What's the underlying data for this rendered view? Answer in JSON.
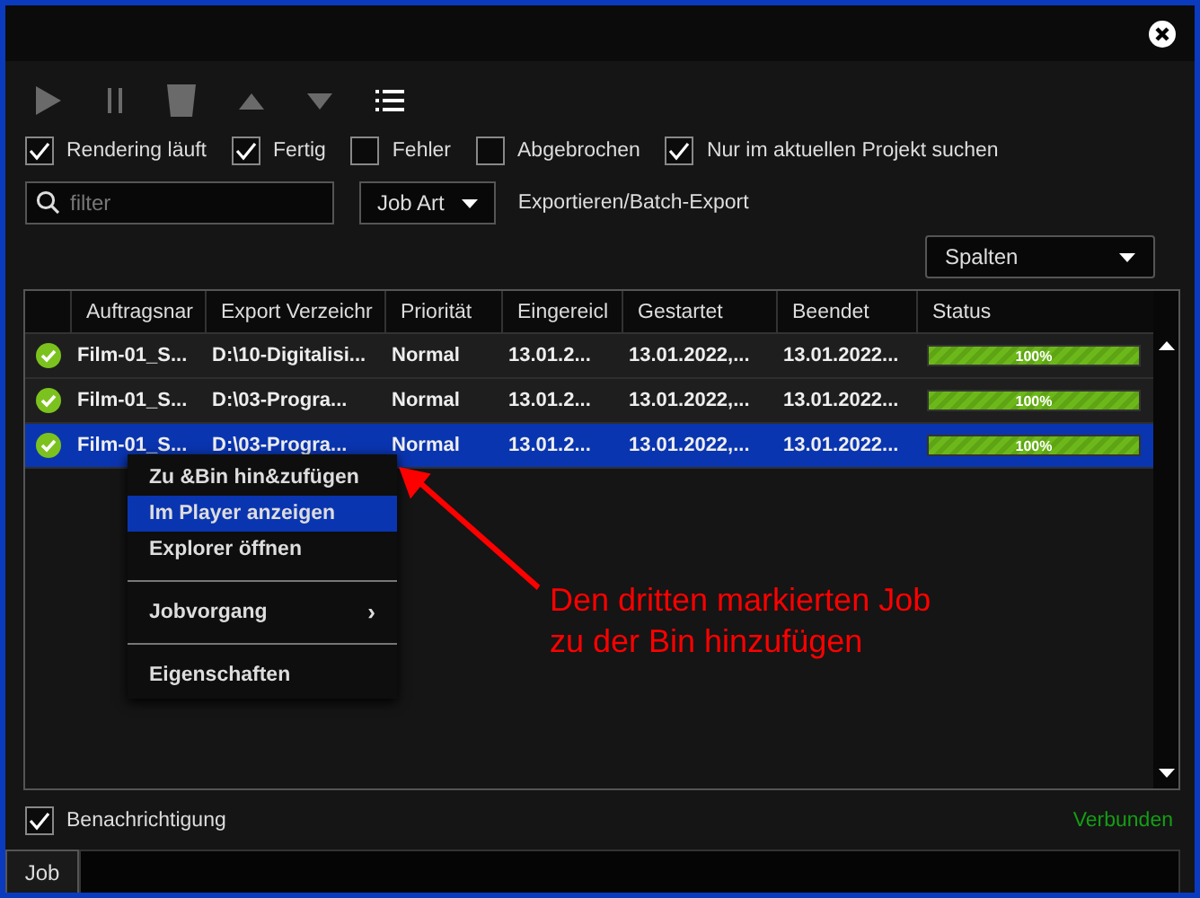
{
  "filters": [
    {
      "label": "Rendering läuft",
      "checked": true
    },
    {
      "label": "Fertig",
      "checked": true
    },
    {
      "label": "Fehler",
      "checked": false
    },
    {
      "label": "Abgebrochen",
      "checked": false
    },
    {
      "label": "Nur im aktuellen Projekt suchen",
      "checked": true
    }
  ],
  "filter_field": {
    "placeholder": "filter"
  },
  "job_type": {
    "label": "Job Art",
    "value": "Exportieren/Batch-Export"
  },
  "columns_button": {
    "label": "Spalten"
  },
  "table": {
    "columns": [
      "Auftragsnar",
      "Export Verzeichr",
      "Priorität",
      "Eingereicl",
      "Gestartet",
      "Beendet",
      "Status"
    ],
    "rows": [
      {
        "selected": false,
        "done": true,
        "cells": [
          "Film-01_S...",
          "D:\\10-Digitalisi...",
          "Normal",
          "13.01.2...",
          "13.01.2022,...",
          "13.01.2022..."
        ],
        "progress": {
          "level": 1,
          "text": "100%"
        }
      },
      {
        "selected": false,
        "done": true,
        "cells": [
          "Film-01_S...",
          "D:\\03-Progra...",
          "Normal",
          "13.01.2...",
          "13.01.2022,...",
          "13.01.2022..."
        ],
        "progress": {
          "level": 1,
          "text": "100%"
        }
      },
      {
        "selected": true,
        "done": true,
        "cells": [
          "Film-01_S...",
          "D:\\03-Progra...",
          "Normal",
          "13.01.2...",
          "13.01.2022,...",
          "13.01.2022..."
        ],
        "progress": {
          "level": 1,
          "text": "100%"
        }
      }
    ]
  },
  "context_menu": {
    "groups": [
      [
        {
          "label": "Zu &Bin hin&zufügen",
          "selected": false
        },
        {
          "label": "Im Player anzeigen",
          "selected": true
        },
        {
          "label": "Explorer öffnen",
          "selected": false
        }
      ],
      [
        {
          "label": "Jobvorgang",
          "selected": false,
          "arrow": "›"
        }
      ],
      [
        {
          "label": "Eigenschaften",
          "selected": false
        }
      ]
    ]
  },
  "annotation": {
    "lines": [
      "Den dritten markierten Job",
      "zu der Bin hinzufügen"
    ]
  },
  "notification": {
    "label": "Benachrichtigung",
    "checked": true
  },
  "connection_status": "Verbunden",
  "bottom_tabs": [
    {
      "label": "Job",
      "selected": true
    }
  ]
}
